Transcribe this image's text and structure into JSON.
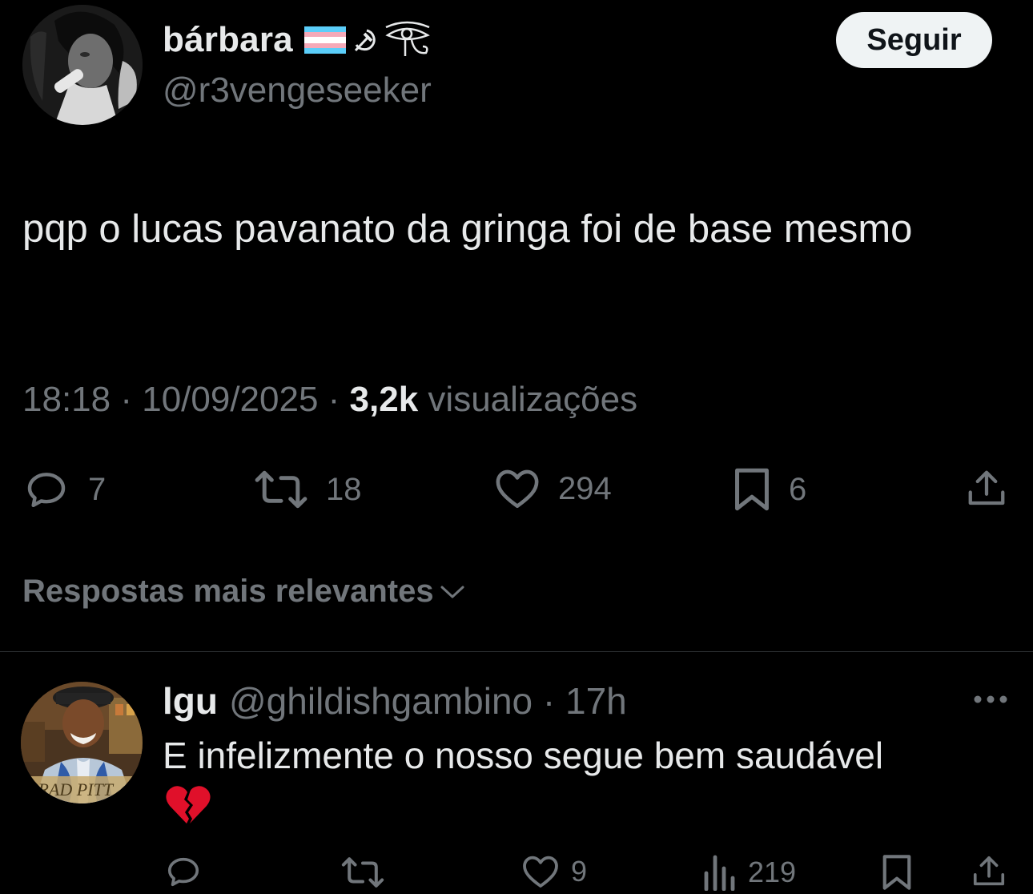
{
  "tweet": {
    "author": {
      "display_name": "bárbara",
      "handle": "@r3vengeseeker",
      "name_emojis": [
        "transgender-flag-icon",
        "hammer-sickle-icon",
        "eye-of-horus-icon"
      ]
    },
    "follow_label": "Seguir",
    "text": "pqp o lucas pavanato da gringa foi de base mesmo",
    "time": "18:18",
    "date": "10/09/2025",
    "views_count": "3,2k",
    "views_label": "visualizações",
    "stats": {
      "replies": "7",
      "retweets": "18",
      "likes": "294",
      "bookmarks": "6"
    }
  },
  "replies_sort_label": "Respostas mais relevantes",
  "reply": {
    "display_name": "lgu",
    "handle": "@ghildishgambino",
    "time": "17h",
    "text": "E infelizmente o nosso segue bem saudável",
    "emoji": "broken-heart-icon",
    "avatar_caption": "BRAD PITT",
    "stats": {
      "likes": "9",
      "views": "219"
    }
  },
  "colors": {
    "background": "#000000",
    "text_primary": "#e7e9ea",
    "text_secondary": "#71767b",
    "divider": "#2f3336",
    "follow_button_bg": "#eff3f4"
  }
}
